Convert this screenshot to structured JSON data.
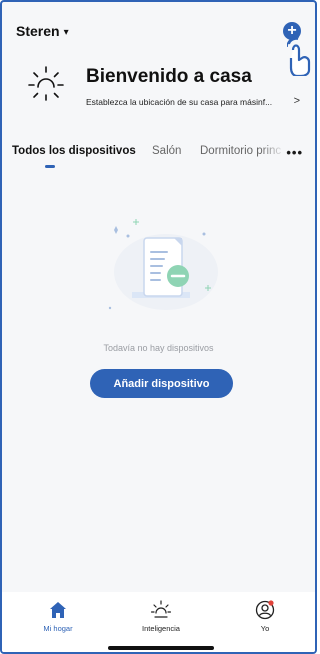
{
  "header": {
    "home_name": "Steren",
    "chevron": "⌄"
  },
  "welcome": {
    "title": "Bienvenido a casa",
    "subtitle": "Establezca la ubicación de su casa para másinf...",
    "arrow": ">"
  },
  "tabs": [
    {
      "label": "Todos los dispositivos",
      "active": true
    },
    {
      "label": "Salón",
      "active": false
    },
    {
      "label": "Dormitorio princ",
      "active": false
    }
  ],
  "more_label": "•••",
  "empty_state": {
    "message": "Todavía no hay dispositivos",
    "button_label": "Añadir dispositivo"
  },
  "bottom_nav": [
    {
      "label": "Mi hogar",
      "icon": "home-icon",
      "active": true
    },
    {
      "label": "Inteligencia",
      "icon": "sun-icon",
      "active": false
    },
    {
      "label": "Yo",
      "icon": "user-icon",
      "active": false
    }
  ],
  "colors": {
    "accent": "#2f63b6",
    "background": "#f6f7f9",
    "notification_dot": "#e0433a"
  }
}
